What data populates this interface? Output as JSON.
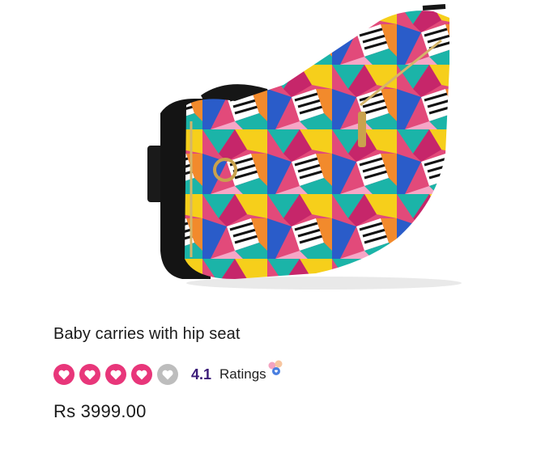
{
  "product": {
    "title": "Baby carries with hip seat",
    "rating_value": "4.1",
    "ratings_label": "Ratings",
    "price": "Rs 3999.00",
    "stars_filled": 4,
    "stars_total": 5
  },
  "colors": {
    "star_filled": "#e8367a",
    "star_empty": "#bdbdbd",
    "rating_value": "#3a1a78"
  },
  "icons": {
    "star": "heart-circle-icon",
    "ratings": "rating-bubbles-icon"
  }
}
